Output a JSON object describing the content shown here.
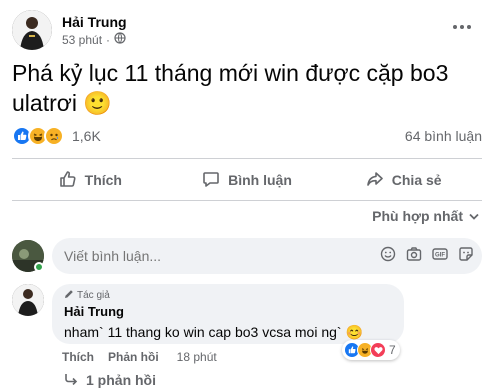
{
  "post": {
    "author": "Hải Trung",
    "time": "53 phút",
    "separator": "·",
    "text": "Phá kỷ lục 11 tháng mới win được cặp bo3 ulatrơi",
    "emoji": "🙂"
  },
  "stats": {
    "reactions_count": "1,6K",
    "comments_count": "64 bình luận"
  },
  "actions": {
    "like": "Thích",
    "comment": "Bình luận",
    "share": "Chia sẻ"
  },
  "sort": {
    "label": "Phù hợp nhất"
  },
  "composer": {
    "placeholder": "Viết bình luận..."
  },
  "comment": {
    "badge": "Tác giả",
    "author": "Hải Trung",
    "text": "nham` 11 thang ko win cap bo3 vcsa moi ng`",
    "emoji": "😊",
    "reactions_count": "7",
    "like": "Thích",
    "reply": "Phản hồi",
    "time": "18 phút"
  },
  "replies": {
    "label": "1 phản hồi"
  },
  "colors": {
    "like_blue": "#1877f2",
    "haha_yellow": "#f7b125",
    "love_red": "#f33e58",
    "secondary_text": "#65676b"
  },
  "icons": [
    "globe-icon",
    "more-icon",
    "like-icon",
    "haha-icon",
    "sad-icon",
    "comment-icon",
    "share-icon",
    "chevron-down-icon",
    "emoji-icon",
    "camera-icon",
    "gif-icon",
    "sticker-icon",
    "pencil-icon",
    "reply-arrow-icon",
    "love-icon"
  ]
}
